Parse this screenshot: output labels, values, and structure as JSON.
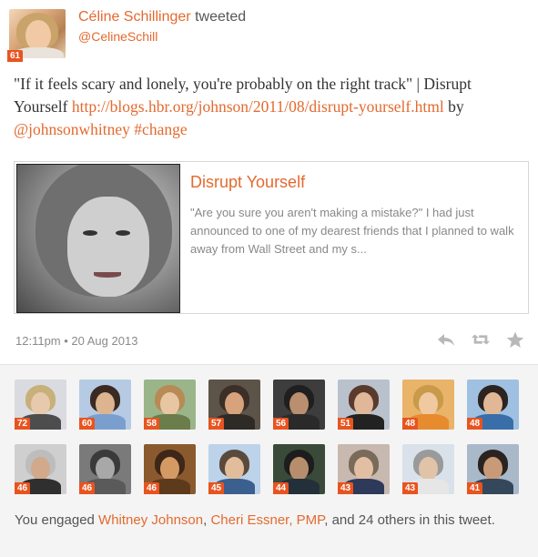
{
  "author": {
    "name": "Céline Schillinger",
    "verb": "tweeted",
    "handle": "@CelineSchill",
    "score": "61"
  },
  "tweet": {
    "text_1": "\"If it feels scary and lonely, you're probably on the right track\" | Disrupt Yourself ",
    "link": "http://blogs.hbr.org/johnson/2011/08/disrupt-yourself.html",
    "text_2": " by ",
    "mention": "@johnsonwhitney",
    "text_3": " ",
    "hashtag": "#change"
  },
  "preview": {
    "title": "Disrupt Yourself",
    "description": "\"Are you sure you aren't making a mistake?\" I had just announced to one of my dearest friends that I planned to walk away from Wall Street and my s..."
  },
  "meta": {
    "timestamp": "12:11pm • 20 Aug 2013"
  },
  "actions": {
    "reply_icon": "reply-icon",
    "retweet_icon": "retweet-icon",
    "favorite_icon": "star-icon"
  },
  "engagers": [
    {
      "score": "72",
      "bg": "#d9dbe0",
      "hair": "#c7b07a",
      "face": "#e7c9ad",
      "shirt": "#4d4d4d"
    },
    {
      "score": "60",
      "bg": "#b6cbe3",
      "hair": "#3a2a22",
      "face": "#dcb48f",
      "shirt": "#7a9fcf"
    },
    {
      "score": "58",
      "bg": "#9bb58a",
      "hair": "#b88a55",
      "face": "#e8c6a3",
      "shirt": "#6b7d4a"
    },
    {
      "score": "57",
      "bg": "#5c5349",
      "hair": "#3b2f27",
      "face": "#d7a27c",
      "shirt": "#2e2a26"
    },
    {
      "score": "56",
      "bg": "#3d3d3d",
      "hair": "#1f1f1f",
      "face": "#b98f6f",
      "shirt": "#2a2a2a"
    },
    {
      "score": "51",
      "bg": "#b9c2cc",
      "hair": "#5a3a2c",
      "face": "#e0b799",
      "shirt": "#222"
    },
    {
      "score": "48",
      "bg": "#e9b36a",
      "hair": "#c99a4a",
      "face": "#f0c9a0",
      "shirt": "#e78b2f"
    },
    {
      "score": "48",
      "bg": "#9fc0e0",
      "hair": "#2c2420",
      "face": "#e1b896",
      "shirt": "#3a6ea8"
    },
    {
      "score": "46",
      "bg": "#cfcfcf",
      "hair": "#bdbdbd",
      "face": "#d2a98a",
      "shirt": "#2f2f2f"
    },
    {
      "score": "46",
      "bg": "#7a7a7a",
      "hair": "#3a3a3a",
      "face": "#a8a8a8",
      "shirt": "#5a5a5a"
    },
    {
      "score": "46",
      "bg": "#8a5a2e",
      "hair": "#3e2718",
      "face": "#d49a63",
      "shirt": "#5e3a1c"
    },
    {
      "score": "45",
      "bg": "#bcd3ea",
      "hair": "#5a4a3c",
      "face": "#e2bd9c",
      "shirt": "#3b5f8e"
    },
    {
      "score": "44",
      "bg": "#3a4a3a",
      "hair": "#1d1d1d",
      "face": "#b78e6d",
      "shirt": "#23303a"
    },
    {
      "score": "43",
      "bg": "#c8b9b0",
      "hair": "#7a6a5a",
      "face": "#e2bfa2",
      "shirt": "#2e3a5a"
    },
    {
      "score": "43",
      "bg": "#d9e2ea",
      "hair": "#9a9a9a",
      "face": "#e1c3a8",
      "shirt": "#e6e6e6"
    },
    {
      "score": "41",
      "bg": "#a9b9c9",
      "hair": "#2a2420",
      "face": "#c99a78",
      "shirt": "#35475a"
    }
  ],
  "engagement": {
    "text_1": "You engaged ",
    "user_1": "Whitney Johnson",
    "sep_1": ", ",
    "user_2": "Cheri Essner, PMP",
    "text_2": ", and 24 others in this tweet."
  }
}
